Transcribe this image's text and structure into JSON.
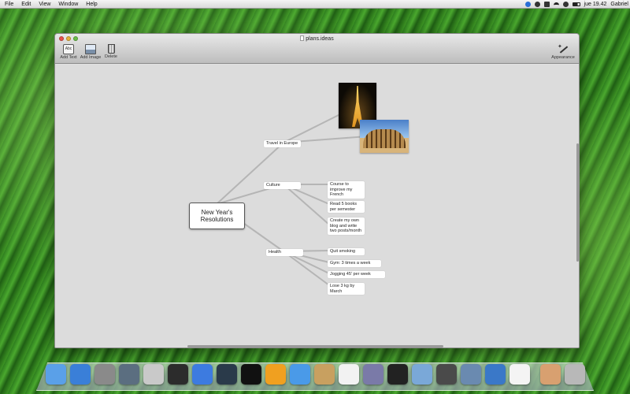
{
  "menubar": {
    "items": [
      "File",
      "Edit",
      "View",
      "Window",
      "Help"
    ],
    "clock": "jue 19.42",
    "user": "Gabriel"
  },
  "window": {
    "title": "plans.ideas",
    "toolbar": {
      "add_text_label": "Add Text",
      "add_text_icon_text": "Abc",
      "add_image_label": "Add Image",
      "delete_label": "Delete",
      "appearance_label": "Appearance"
    }
  },
  "mindmap": {
    "central": "New Year's Resolutions",
    "branches": {
      "travel": {
        "label": "Travel in Europe"
      },
      "culture": {
        "label": "Culture",
        "children": [
          "Course to improve my French",
          "Read 5 books per semester",
          "Create my own blog and write two posts/month"
        ]
      },
      "health": {
        "label": "Health",
        "children": [
          "Quit smoking",
          "Gym: 3 times a week",
          "Jogging 45' per week",
          "Lose 3 kg by March"
        ]
      }
    },
    "images": [
      "eiffel-tower-photo",
      "colosseum-photo"
    ],
    "line_color": "#b5b5b5"
  },
  "dock": {
    "apps": [
      {
        "name": "finder",
        "color": "#5aa0e8"
      },
      {
        "name": "app-store",
        "color": "#3a7fd8"
      },
      {
        "name": "launchpad",
        "color": "#8a8a8a"
      },
      {
        "name": "mission-control",
        "color": "#5b6e80"
      },
      {
        "name": "address-book",
        "color": "#c9c9c9"
      },
      {
        "name": "dashboard",
        "color": "#2c2c2c"
      },
      {
        "name": "itunes",
        "color": "#3d7be0"
      },
      {
        "name": "equalizer",
        "color": "#2a3a4a"
      },
      {
        "name": "blob-app",
        "color": "#111111"
      },
      {
        "name": "sublime",
        "color": "#f0a020"
      },
      {
        "name": "safari",
        "color": "#4a9ae8"
      },
      {
        "name": "notebook",
        "color": "#c8a060"
      },
      {
        "name": "calendar",
        "color": "#f2f2f2"
      },
      {
        "name": "photo-booth",
        "color": "#7a7aa8"
      },
      {
        "name": "terminal",
        "color": "#222222"
      },
      {
        "name": "mail",
        "color": "#7aa8d8"
      },
      {
        "name": "facetime",
        "color": "#4a4a4a"
      },
      {
        "name": "preview",
        "color": "#6a8ab0"
      },
      {
        "name": "xcode",
        "color": "#3a78c8"
      },
      {
        "name": "messages",
        "color": "#f4f4f4"
      },
      {
        "name": "downloads",
        "color": "#d8a070"
      },
      {
        "name": "trash",
        "color": "#b8b8b8"
      }
    ]
  }
}
